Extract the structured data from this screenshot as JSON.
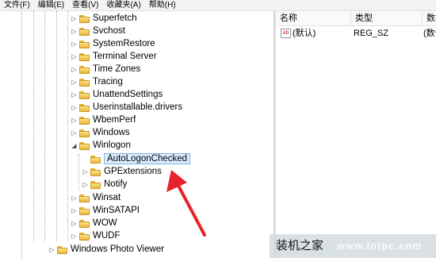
{
  "menu": [
    "文件(F)",
    "编辑(E)",
    "查看(V)",
    "收藏夹(A)",
    "帮助(H)"
  ],
  "tree": {
    "items": [
      "Superfetch",
      "Svchost",
      "SystemRestore",
      "Terminal Server",
      "Time Zones",
      "Tracing",
      "UnattendSettings",
      "Userinstallable.drivers",
      "WbemPerf",
      "Windows",
      "Winlogon"
    ],
    "winlogon_children": [
      "AutoLogonChecked",
      "GPExtensions",
      "Notify"
    ],
    "items_after": [
      "Winsat",
      "WinSATAPI",
      "WOW",
      "WUDF"
    ],
    "bottom_item": "Windows Photo Viewer"
  },
  "list": {
    "headers": [
      "名称",
      "类型",
      "数据"
    ],
    "rows": [
      {
        "name": "(默认)",
        "type": "REG_SZ",
        "data": "(数值"
      }
    ]
  },
  "colors": {
    "selection": "#dbeeff",
    "arrow": "#e8222a",
    "folder": "#f0c040"
  },
  "watermark": {
    "text": "装机之家",
    "url": "www.lotpc.com"
  }
}
